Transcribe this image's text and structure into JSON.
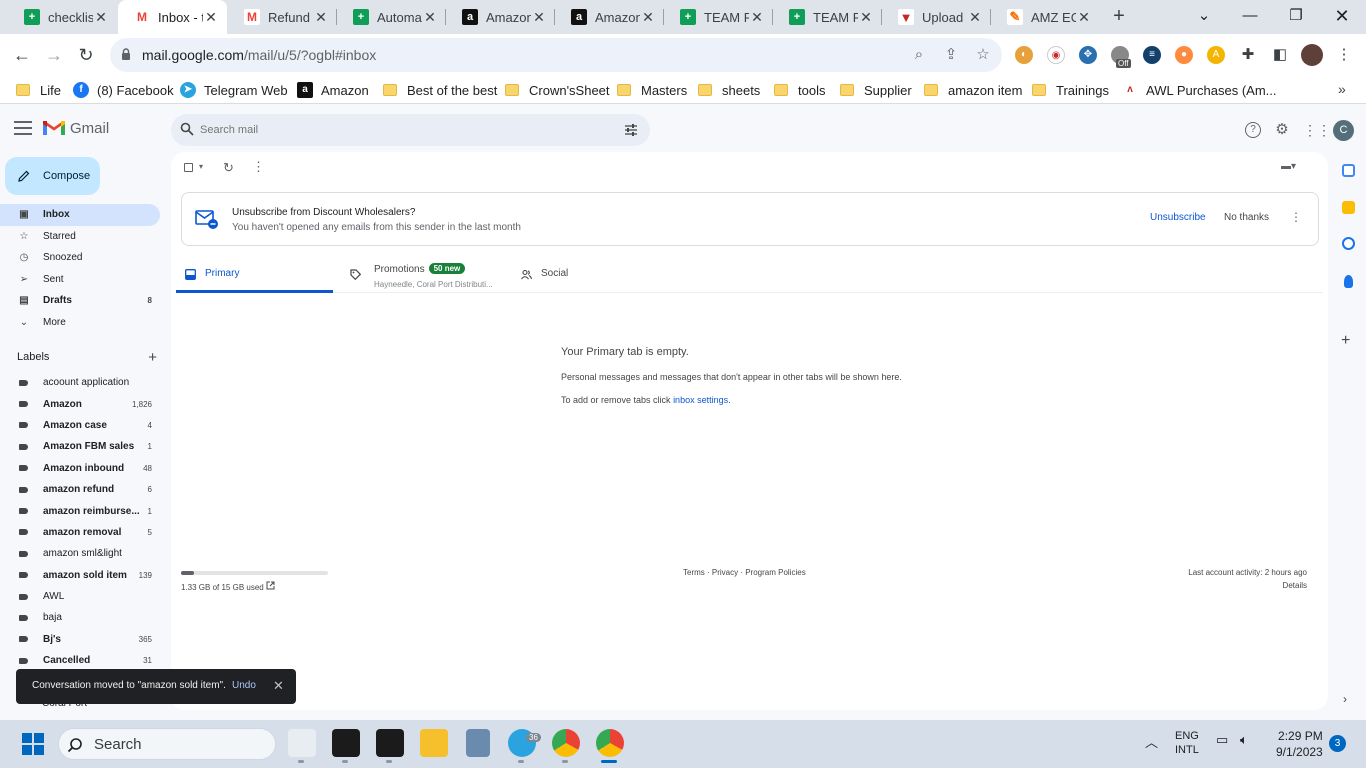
{
  "browser": {
    "tabs": [
      {
        "title": "checklist",
        "favicon": "sheets-icon",
        "active": false
      },
      {
        "title": "Inbox - t",
        "favicon": "gmail-icon",
        "active": true
      },
      {
        "title": "Refund I",
        "favicon": "gmail-icon",
        "active": false
      },
      {
        "title": "Automat",
        "favicon": "sheets-icon",
        "active": false
      },
      {
        "title": "Amazon",
        "favicon": "amazon-icon",
        "active": false
      },
      {
        "title": "Amazon",
        "favicon": "amazon-icon",
        "active": false
      },
      {
        "title": "TEAM RE",
        "favicon": "sheets-icon",
        "active": false
      },
      {
        "title": "TEAM RE",
        "favicon": "sheets-icon",
        "active": false
      },
      {
        "title": "Upload",
        "favicon": "upload-icon",
        "active": false
      },
      {
        "title": "AMZ EC",
        "favicon": "amz-icon",
        "active": false
      }
    ],
    "new_tab": "+",
    "url_host": "mail.google.com",
    "url_path": "/mail/u/5/?ogbl#inbox",
    "bookmarks": [
      {
        "label": "Life",
        "type": "folder"
      },
      {
        "label": "(8) Facebook",
        "type": "facebook"
      },
      {
        "label": "Telegram Web",
        "type": "telegram"
      },
      {
        "label": "Amazon",
        "type": "amazon"
      },
      {
        "label": "Best of the best",
        "type": "folder"
      },
      {
        "label": "Crown'sSheet",
        "type": "folder"
      },
      {
        "label": "Masters",
        "type": "folder"
      },
      {
        "label": "sheets",
        "type": "folder"
      },
      {
        "label": "tools",
        "type": "folder"
      },
      {
        "label": "Supplier",
        "type": "folder"
      },
      {
        "label": "amazon item",
        "type": "folder"
      },
      {
        "label": "Trainings",
        "type": "folder"
      },
      {
        "label": "AWL Purchases (Am...",
        "type": "awl"
      }
    ],
    "ext_off_badge": "Off"
  },
  "gmail": {
    "app_name": "Gmail",
    "search_placeholder": "Search mail",
    "avatar_letter": "C",
    "compose_label": "Compose",
    "nav": [
      {
        "label": "Inbox",
        "icon": "inbox-icon",
        "count": "",
        "active": true,
        "bold": true
      },
      {
        "label": "Starred",
        "icon": "star-icon",
        "count": "",
        "active": false,
        "bold": false
      },
      {
        "label": "Snoozed",
        "icon": "clock-icon",
        "count": "",
        "active": false,
        "bold": false
      },
      {
        "label": "Sent",
        "icon": "send-icon",
        "count": "",
        "active": false,
        "bold": false
      },
      {
        "label": "Drafts",
        "icon": "draft-icon",
        "count": "8",
        "active": false,
        "bold": true
      },
      {
        "label": "More",
        "icon": "chevron-down-icon",
        "count": "",
        "active": false,
        "bold": false
      }
    ],
    "labels_title": "Labels",
    "labels": [
      {
        "name": "acoount application",
        "count": "",
        "bold": false
      },
      {
        "name": "Amazon",
        "count": "1,826",
        "bold": true
      },
      {
        "name": "Amazon case",
        "count": "4",
        "bold": true
      },
      {
        "name": "Amazon FBM sales",
        "count": "1",
        "bold": true
      },
      {
        "name": "Amazon inbound",
        "count": "48",
        "bold": true
      },
      {
        "name": "amazon refund",
        "count": "6",
        "bold": true
      },
      {
        "name": "amazon reimburse...",
        "count": "1",
        "bold": true
      },
      {
        "name": "amazon removal",
        "count": "5",
        "bold": true
      },
      {
        "name": "amazon sml&light",
        "count": "",
        "bold": false
      },
      {
        "name": "amazon sold item",
        "count": "139",
        "bold": true
      },
      {
        "name": "AWL",
        "count": "",
        "bold": false
      },
      {
        "name": "baja",
        "count": "",
        "bold": false
      },
      {
        "name": "Bj's",
        "count": "365",
        "bold": true
      },
      {
        "name": "Cancelled",
        "count": "31",
        "bold": true
      }
    ],
    "label_under_toast": "Coral Port",
    "banner": {
      "title": "Unsubscribe from Discount Wholesalers?",
      "subtitle": "You haven't opened any emails from this sender in the last month",
      "unsubscribe": "Unsubscribe",
      "no_thanks": "No thanks"
    },
    "tabs": [
      {
        "label": "Primary",
        "badge": "",
        "sub": "",
        "active": true
      },
      {
        "label": "Promotions",
        "badge": "50 new",
        "sub": "Hayneedle, Coral Port Distributi...",
        "active": false
      },
      {
        "label": "Social",
        "badge": "",
        "sub": "",
        "active": false
      }
    ],
    "empty_title": "Your Primary tab is empty.",
    "empty_line1": "Personal messages and messages that don't appear in other tabs will be shown here.",
    "empty_line2_prefix": "To add or remove tabs click ",
    "empty_line2_link": "inbox settings",
    "empty_line2_suffix": ".",
    "storage_used_fraction": 0.089,
    "storage_text": "1.33 GB of 15 GB used",
    "footer_links": "Terms · Privacy · Program Policies",
    "last_activity": "Last account activity: 2 hours ago",
    "details": "Details",
    "toast": {
      "text": "Conversation moved to \"amazon sold item\".",
      "undo": "Undo"
    }
  },
  "taskbar": {
    "search_label": "Search",
    "telegram_badge": "36",
    "lang_top": "ENG",
    "lang_bottom": "INTL",
    "time": "2:29 PM",
    "date": "9/1/2023",
    "notifications": "3"
  },
  "colors": {
    "accent": "#0b57d0",
    "compose_bg": "#c2e7ff",
    "active_nav": "#d3e3fd",
    "promo_badge": "#188038"
  }
}
